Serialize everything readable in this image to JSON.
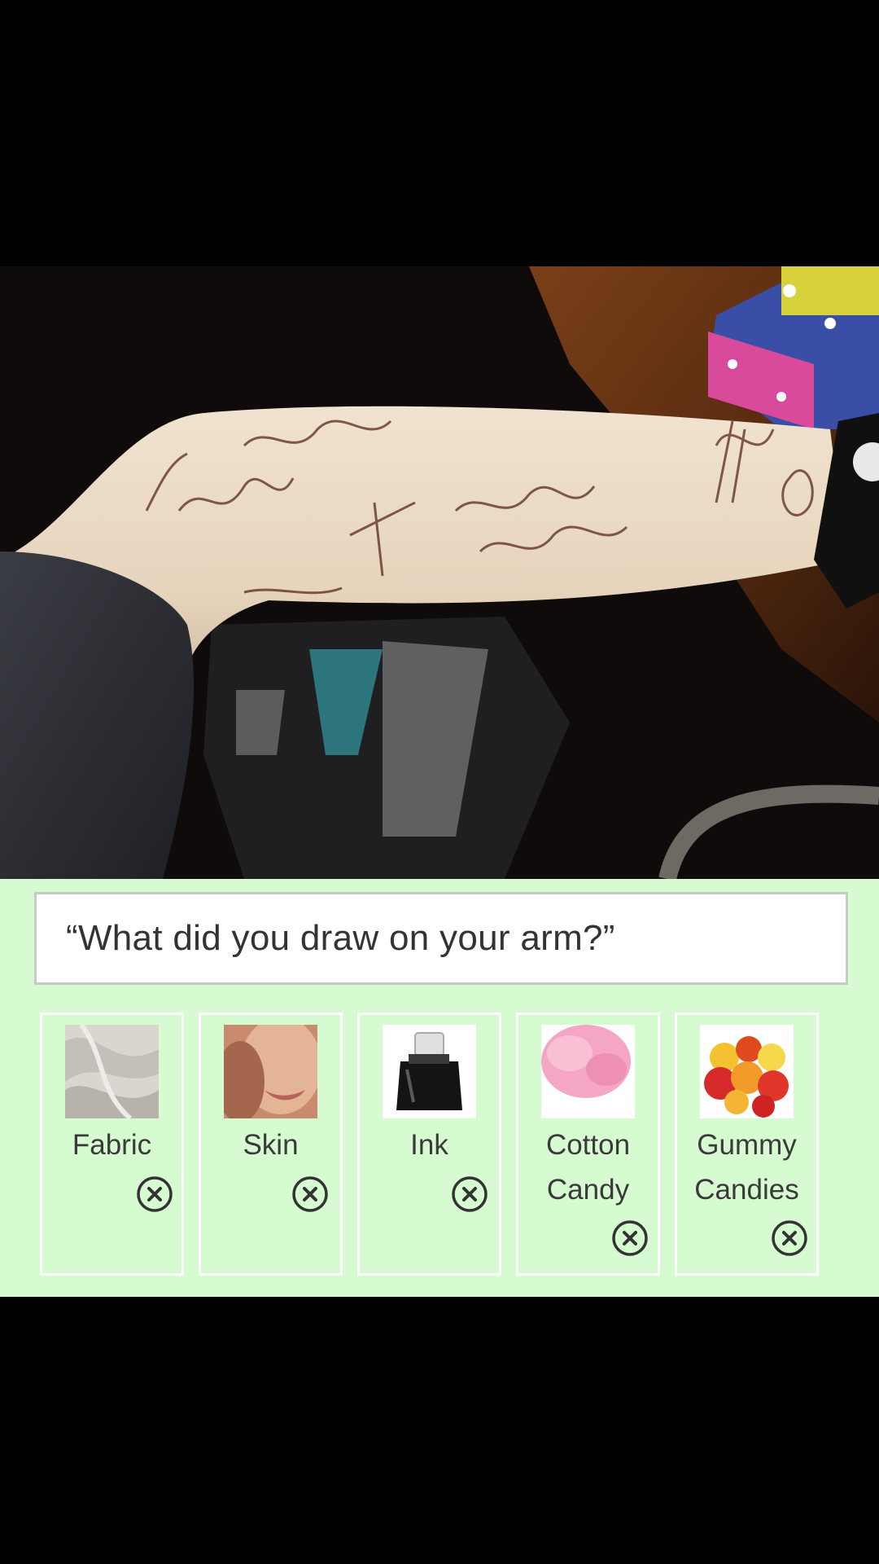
{
  "question": {
    "text": "“What did you draw on your arm?”"
  },
  "options": [
    {
      "label": "Fabric",
      "thumbnail_icon": "fabric-thumbnail",
      "remove_icon": "close-circle-icon"
    },
    {
      "label": "Skin",
      "thumbnail_icon": "skin-thumbnail",
      "remove_icon": "close-circle-icon"
    },
    {
      "label": "Ink",
      "thumbnail_icon": "ink-bottle-thumbnail",
      "remove_icon": "close-circle-icon"
    },
    {
      "label": "Cotton\nCandy",
      "thumbnail_icon": "cotton-candy-thumbnail",
      "remove_icon": "close-circle-icon"
    },
    {
      "label": "Gummy\nCandies",
      "thumbnail_icon": "gummy-candies-thumbnail",
      "remove_icon": "close-circle-icon"
    }
  ],
  "colors": {
    "panel_background": "#d7fbd1",
    "question_background": "#ffffff",
    "card_border": "#ffffff",
    "text": "#333333",
    "screen_background": "#000000"
  }
}
